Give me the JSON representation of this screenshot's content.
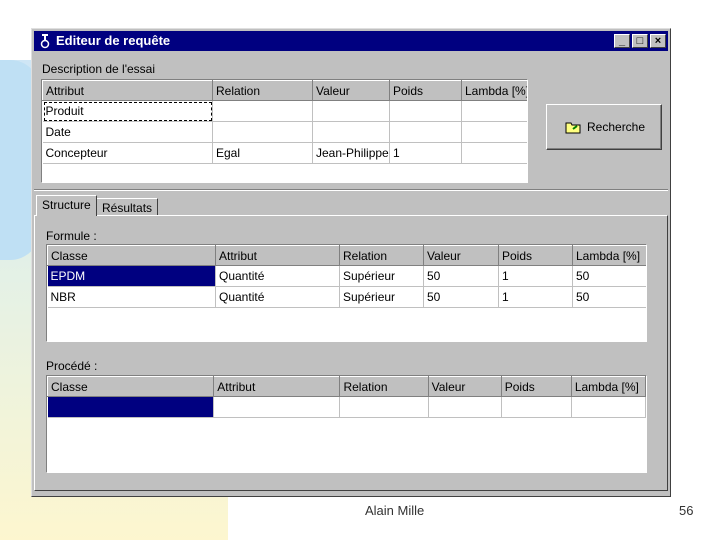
{
  "window": {
    "title": "Editeur de requête",
    "controls": {
      "minimize": "_",
      "maximize": "□",
      "close": "×"
    }
  },
  "description": {
    "label": "Description de l'essai",
    "columns": [
      "Attribut",
      "Relation",
      "Valeur",
      "Poids",
      "Lambda [%]"
    ],
    "rows": [
      [
        "Produit",
        "",
        "",
        "",
        ""
      ],
      [
        "Date",
        "",
        "",
        "",
        ""
      ],
      [
        "Concepteur",
        "Egal",
        "Jean-Philippe",
        "1",
        ""
      ]
    ]
  },
  "search_button": {
    "label": "Recherche",
    "icon": "folder-search-icon"
  },
  "tabs": [
    "Structure",
    "Résultats"
  ],
  "formule": {
    "label": "Formule :",
    "columns": [
      "Classe",
      "Attribut",
      "Relation",
      "Valeur",
      "Poids",
      "Lambda [%]"
    ],
    "rows": [
      [
        "EPDM",
        "Quantité",
        "Supérieur",
        "50",
        "1",
        "50"
      ],
      [
        "NBR",
        "Quantité",
        "Supérieur",
        "50",
        "1",
        "50"
      ]
    ]
  },
  "procede": {
    "label": "Procédé :",
    "columns": [
      "Classe",
      "Attribut",
      "Relation",
      "Valeur",
      "Poids",
      "Lambda [%]"
    ],
    "rows": [
      [
        "",
        "",
        "",
        "",
        "",
        ""
      ]
    ]
  },
  "footer": {
    "author": "Alain Mille",
    "page": "56"
  }
}
